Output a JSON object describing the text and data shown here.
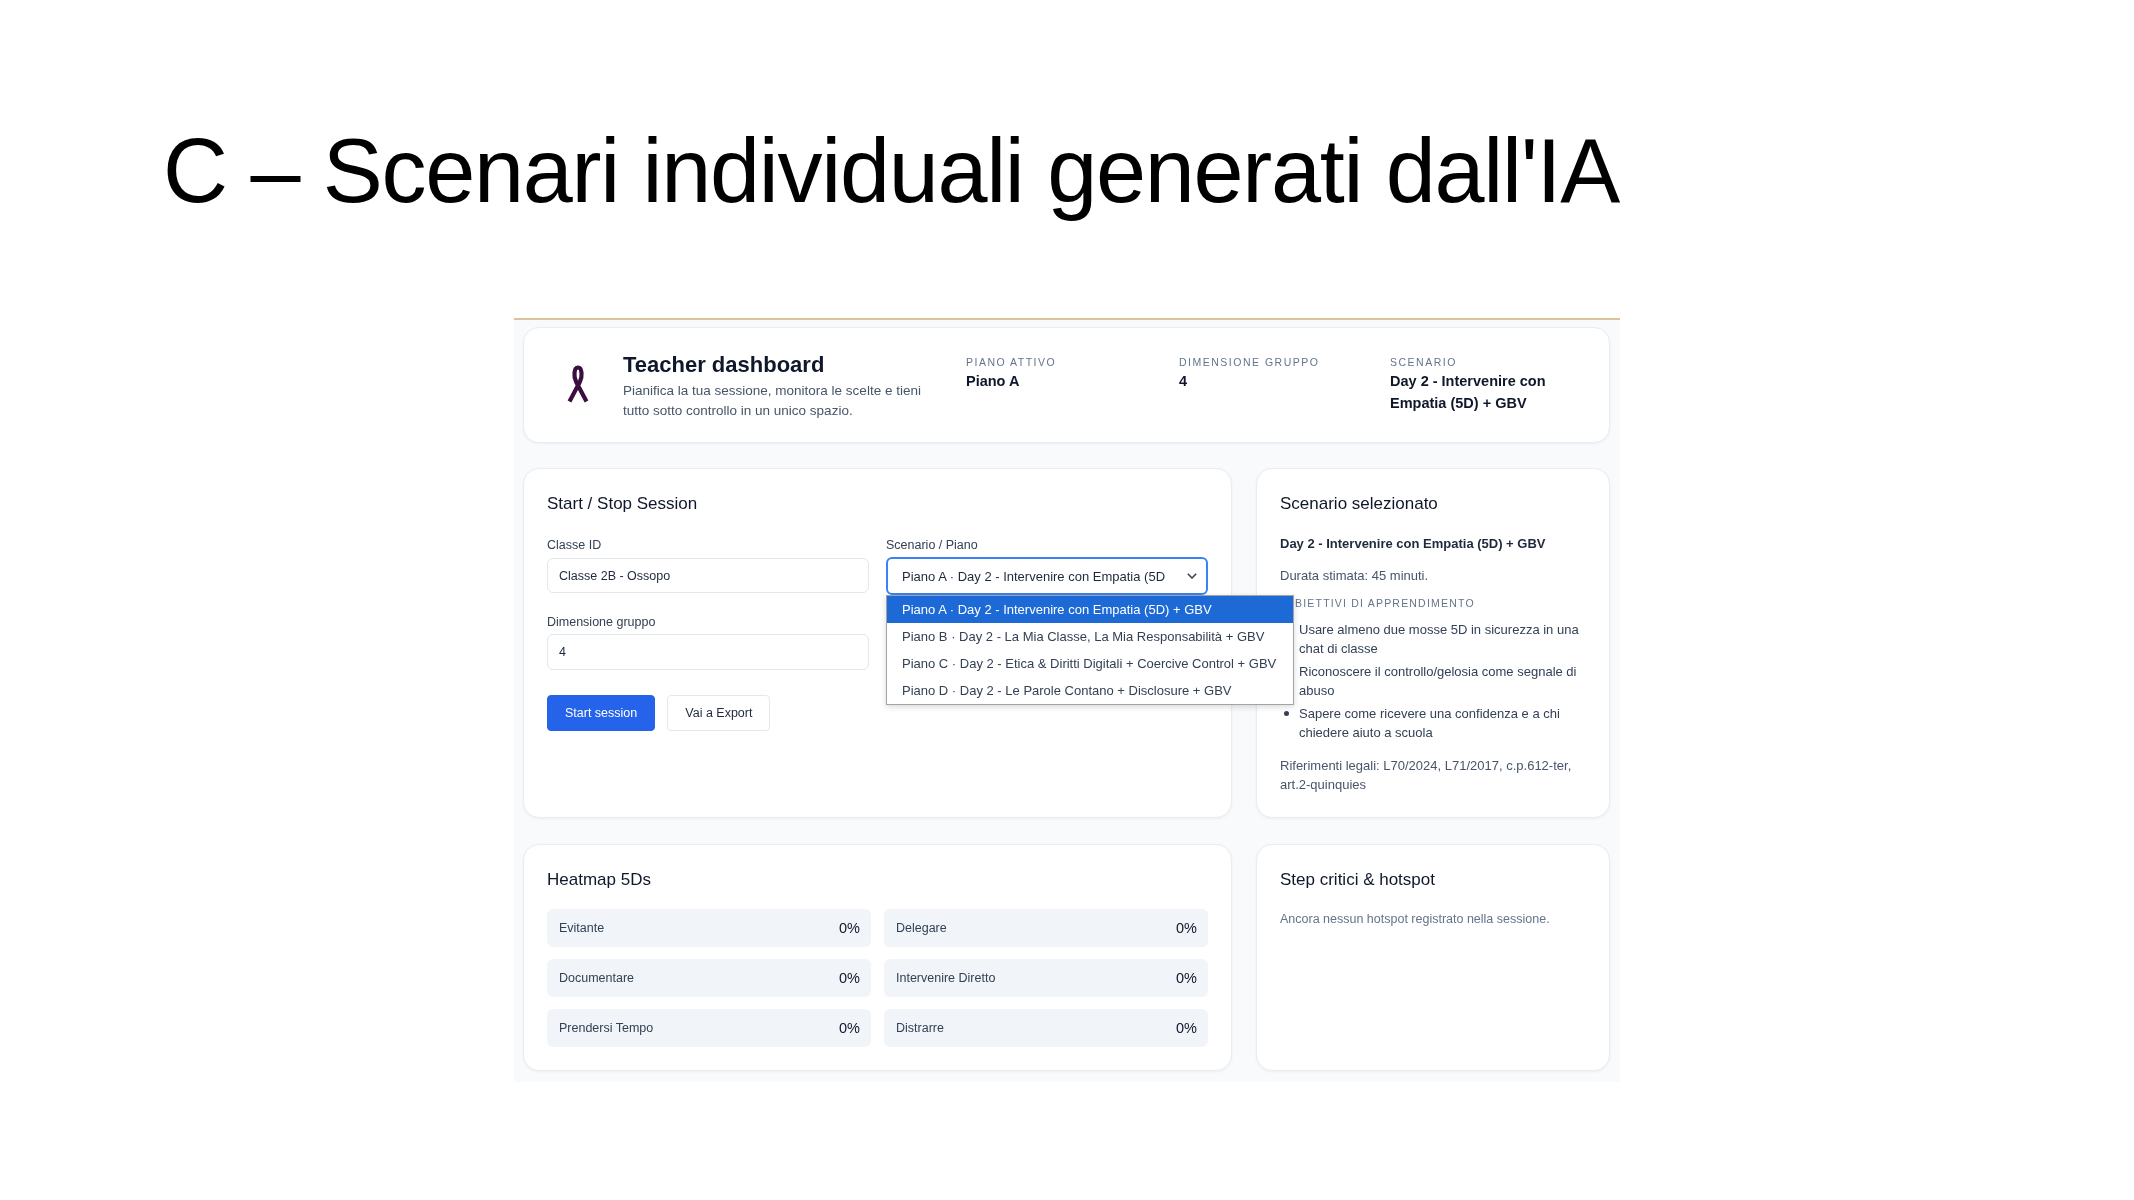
{
  "slide": {
    "title": "C – Scenari individuali generati dall'IA"
  },
  "header": {
    "title": "Teacher dashboard",
    "subtitle": "Pianifica la tua sessione, monitora le scelte e tieni tutto sotto controllo in un unico spazio.",
    "stats": [
      {
        "label": "PIANO ATTIVO",
        "value": "Piano A"
      },
      {
        "label": "DIMENSIONE GRUPPO",
        "value": "4"
      },
      {
        "label": "SCENARIO",
        "value": "Day 2 - Intervenire con Empatia (5D) + GBV"
      }
    ]
  },
  "session_panel": {
    "title": "Start / Stop Session",
    "class_field": {
      "label": "Classe ID",
      "value": "Classe 2B - Ossopo"
    },
    "scenario_select": {
      "label": "Scenario / Piano",
      "value": "Piano A · Day 2 - Intervenire con Empatia (5D",
      "focused": true,
      "expanded": true,
      "options": [
        {
          "label": "Piano A · Day 2 - Intervenire con Empatia (5D) + GBV",
          "selected": true
        },
        {
          "label": "Piano B · Day 2 - La Mia Classe, La Mia Responsabilità + GBV",
          "selected": false
        },
        {
          "label": "Piano C · Day 2 - Etica & Diritti Digitali + Coercive Control + GBV",
          "selected": false
        },
        {
          "label": "Piano D · Day 2 - Le Parole Contano + Disclosure + GBV",
          "selected": false
        }
      ]
    },
    "group_field": {
      "label": "Dimensione gruppo",
      "value": "4"
    },
    "buttons": [
      {
        "label": "Start session",
        "kind": "primary"
      },
      {
        "label": "Vai a Export",
        "kind": "secondary"
      }
    ]
  },
  "scenario_panel": {
    "title": "Scenario selezionato",
    "scenario_name": "Day 2 - Intervenire con Empatia (5D) + GBV",
    "duration": "Durata stimata: 45 minuti.",
    "objectives_heading": "BIETTIVI DI APPRENDIMENTO",
    "objectives": [
      "Usare almeno due mosse 5D in sicurezza in una chat di classe",
      "Riconoscere il controllo/gelosia come segnale di abuso",
      "Sapere come ricevere una confidenza e a chi chiedere aiuto a scuola"
    ],
    "legal_references": "Riferimenti legali: L70/2024, L71/2017, c.p.612-ter, art.2-quinquies"
  },
  "heatmap": {
    "title": "Heatmap 5Ds",
    "cells": [
      {
        "label": "Evitante",
        "value": "0%"
      },
      {
        "label": "Delegare",
        "value": "0%"
      },
      {
        "label": "Documentare",
        "value": "0%"
      },
      {
        "label": "Intervenire Diretto",
        "value": "0%"
      },
      {
        "label": "Prendersi Tempo",
        "value": "0%"
      },
      {
        "label": "Distrarre",
        "value": "0%"
      }
    ]
  },
  "hotspots": {
    "title": "Step critici & hotspot",
    "empty_message": "Ancora nessun hotspot registrato nella sessione."
  }
}
